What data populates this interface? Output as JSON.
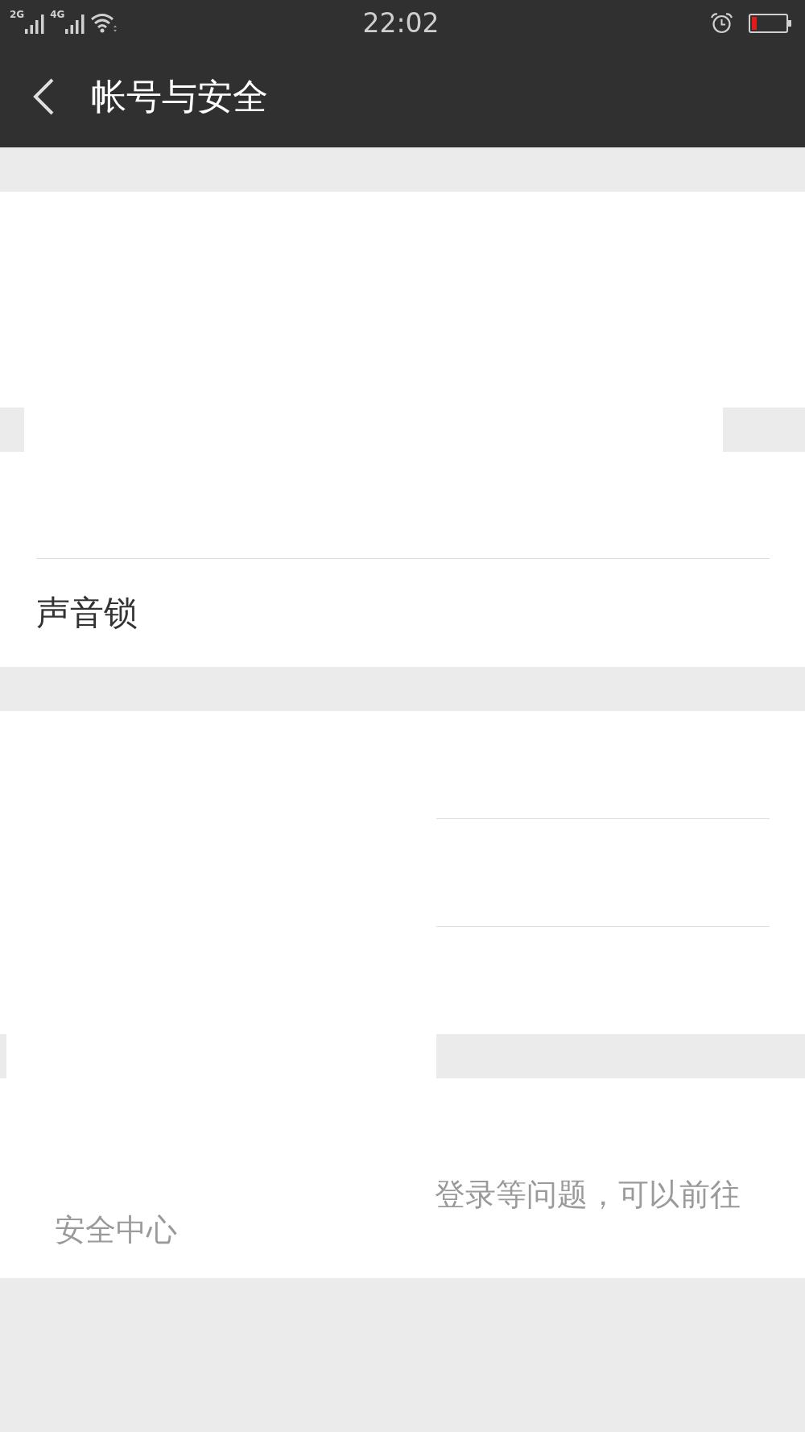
{
  "status_bar": {
    "networks": [
      {
        "label": "2G"
      },
      {
        "label": "4G"
      }
    ],
    "time": "22:02"
  },
  "nav_bar": {
    "title": "帐号与安全"
  },
  "settings_group": {
    "items": [
      {
        "label": "声音锁"
      }
    ]
  },
  "footer_note": {
    "lines": [
      "登录等问题，可以前往",
      "安全中心"
    ]
  }
}
